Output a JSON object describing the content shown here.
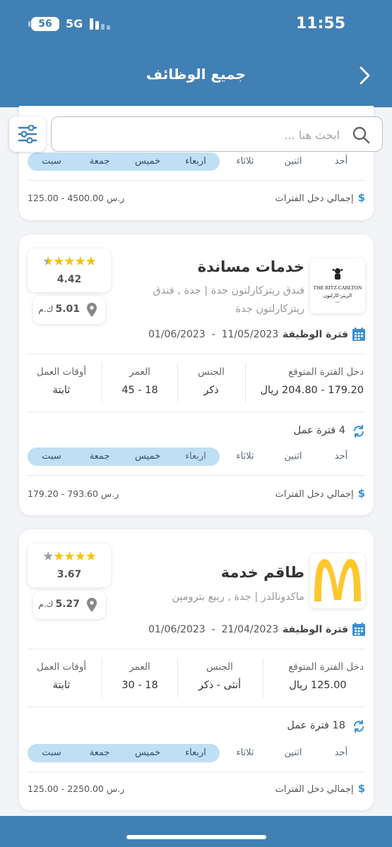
{
  "status_bar": {
    "battery": "56",
    "network": "5G",
    "time": "11:55"
  },
  "header": {
    "title": "جميع الوظائف"
  },
  "search": {
    "placeholder": "ابحث هنا ..."
  },
  "days": [
    "أحد",
    "اثنين",
    "ثلاثاء",
    "اربعاء",
    "خميس",
    "جمعة",
    "سبت"
  ],
  "labels": {
    "total_income": "إجمالي دخل الفترات",
    "job_period": "فترة الوظيفة",
    "expected_income": "دخل الفترة المتوقع",
    "gender": "الجنس",
    "age": "العمر",
    "work_hours": "أوقات العمل",
    "distance_unit": "ك.م"
  },
  "partial_card": {
    "total_value": "125.00 - 4500.00 ر.س"
  },
  "jobs": [
    {
      "title": "خدمات مساندة",
      "company_line1": "فندق ريتزكارلتون جدة | جدة , فندق",
      "company_line2": "ريتزكارلتون جدة",
      "logo_text_en": "THE RITZ-CARLTON",
      "logo_text_ar": "الريتز-كارلتون",
      "logo_text_city": "جدة",
      "rating": 4.42,
      "rating_text": "4.42",
      "distance": "5.01",
      "period_start": "11/05/2023",
      "period_end": "01/06/2023",
      "expected_income": "179.20 - 204.80 ريال",
      "gender": "ذكر",
      "age": "18 - 45",
      "work_hours": "ثابتة",
      "shifts": "4 فترة عمل",
      "total_value": "179.20 - 793.60 ر.س"
    },
    {
      "title": "طاقم خدمة",
      "company_line1": "ماكدونالدز | جدة , ربيع بترومين",
      "rating": 3.67,
      "rating_text": "3.67",
      "distance": "5.27",
      "period_start": "21/04/2023",
      "period_end": "01/06/2023",
      "expected_income": "125.00 ريال",
      "gender": "أنثى - ذكر",
      "age": "18 - 30",
      "work_hours": "ثابتة",
      "shifts": "18 فترة عمل",
      "total_value": "125.00 - 2250.00 ر.س"
    }
  ],
  "colors": {
    "header": "#4180b4",
    "accent": "#3a8fd0",
    "pill": "#bfdff5",
    "star": "#f1c40f",
    "mcd_yellow": "#ffc72c"
  }
}
